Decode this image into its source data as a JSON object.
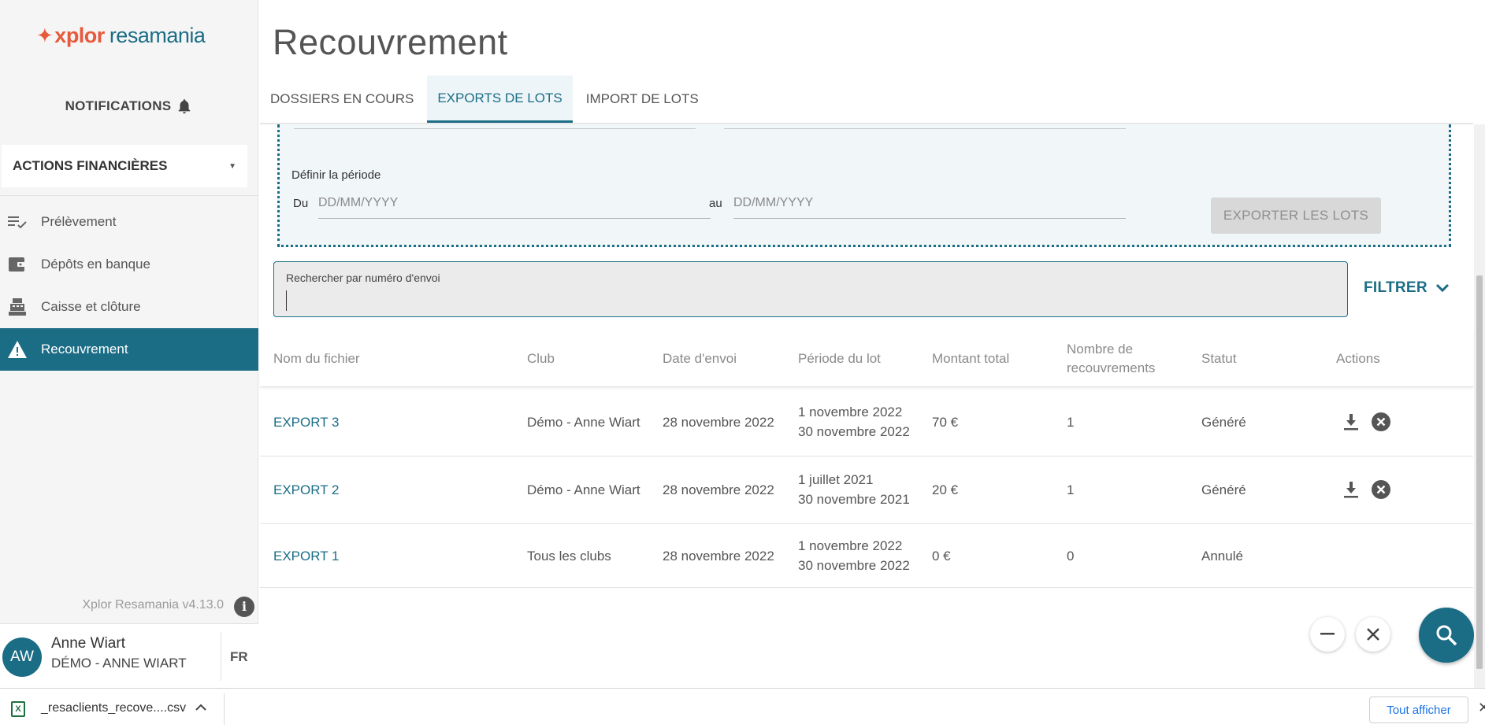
{
  "sidebar": {
    "logo_primary": "xplor",
    "logo_secondary": "resamania",
    "notifications_label": "NOTIFICATIONS",
    "section_label": "ACTIONS FINANCIÈRES",
    "items": [
      {
        "label": "Prélèvement",
        "icon": "checklist-icon"
      },
      {
        "label": "Dépôts en banque",
        "icon": "wallet-icon"
      },
      {
        "label": "Caisse et clôture",
        "icon": "cash-register-icon"
      },
      {
        "label": "Recouvrement",
        "icon": "warning-icon",
        "active": true
      }
    ],
    "version": "Xplor Resamania v4.13.0",
    "user": {
      "initials": "AW",
      "name": "Anne Wiart",
      "club": "DÉMO - ANNE WIART",
      "lang": "FR"
    }
  },
  "header": {
    "title": "Recouvrement",
    "tabs": [
      {
        "label": "DOSSIERS EN COURS"
      },
      {
        "label": "EXPORTS DE LOTS",
        "active": true
      },
      {
        "label": "IMPORT DE LOTS"
      }
    ]
  },
  "export_panel": {
    "period_label": "Définir la période",
    "from_label": "Du",
    "to_label": "au",
    "from_placeholder": "DD/MM/YYYY",
    "to_placeholder": "DD/MM/YYYY",
    "export_button": "EXPORTER LES LOTS"
  },
  "search": {
    "label": "Rechercher par numéro d'envoi",
    "value": "",
    "filter_label": "FILTRER"
  },
  "table": {
    "columns": [
      "Nom du fichier",
      "Club",
      "Date d'envoi",
      "Période du lot",
      "Montant total",
      "Nombre de recouvrements",
      "Statut",
      "Actions"
    ],
    "column_lines": {
      "count_line1": "Nombre de",
      "count_line2": "recouvrements"
    },
    "rows": [
      {
        "file": "EXPORT 3",
        "club": "Démo - Anne Wiart",
        "sent": "28 novembre 2022",
        "period_start": "1 novembre 2022",
        "period_end": "30 novembre 2022",
        "amount": "70 €",
        "count": "1",
        "status": "Généré",
        "has_actions": true
      },
      {
        "file": "EXPORT 2",
        "club": "Démo - Anne Wiart",
        "sent": "28 novembre 2022",
        "period_start": "1 juillet 2021",
        "period_end": "30 novembre 2021",
        "amount": "20 €",
        "count": "1",
        "status": "Généré",
        "has_actions": true
      },
      {
        "file": "EXPORT 1",
        "club": "Tous les clubs",
        "sent": "28 novembre 2022",
        "period_start": "1 novembre 2022",
        "period_end": "30 novembre 2022",
        "amount": "0 €",
        "count": "0",
        "status": "Annulé",
        "has_actions": false
      }
    ]
  },
  "download_bar": {
    "file_name": "_resaclients_recove....csv",
    "show_all": "Tout afficher"
  },
  "colors": {
    "brand": "#1b6d86",
    "logo_accent": "#e8593b"
  }
}
